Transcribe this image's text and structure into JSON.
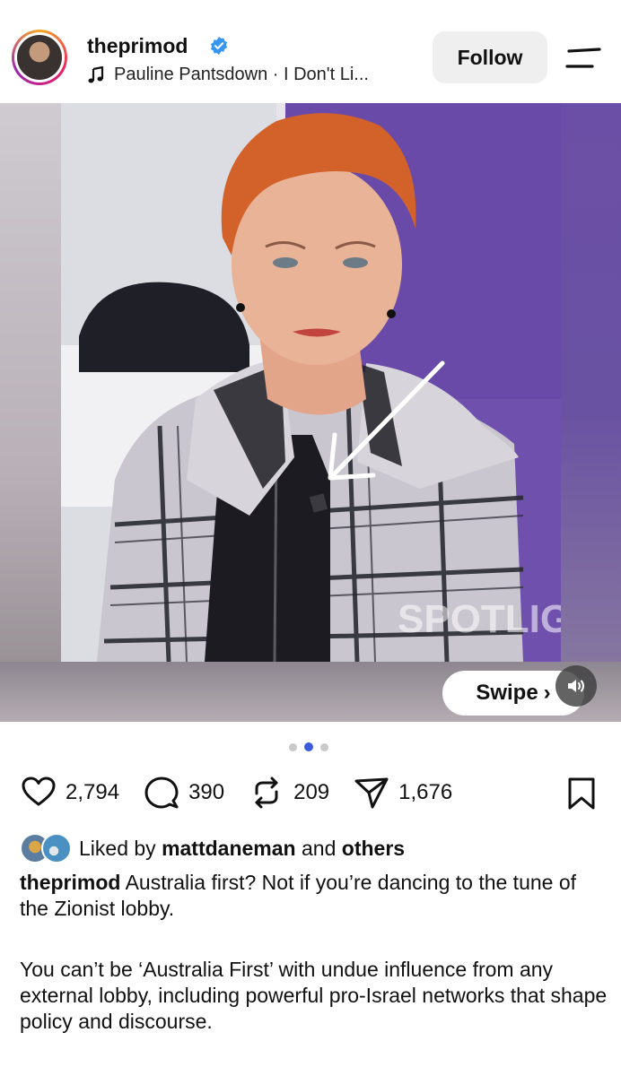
{
  "header": {
    "username": "theprimod",
    "verified_icon": "verified-badge-icon",
    "audio_label": "Pauline Pantsdown · I Don't Li...",
    "follow_label": "Follow"
  },
  "media": {
    "watermark": "SPOTLIGHT",
    "swipe_label": "Swipe",
    "swipe_chevron": "›",
    "carousel_total": 3,
    "carousel_active": 2
  },
  "actions": {
    "likes": "2,794",
    "comments": "390",
    "reposts": "209",
    "shares": "1,676"
  },
  "liked_by": {
    "prefix": "Liked by",
    "user": "mattdaneman",
    "conjunction": "and",
    "others": "others"
  },
  "caption": {
    "author": "theprimod",
    "text": "Australia first? Not if you’re dancing to the tune of the Zionist lobby.",
    "paragraph": "You can’t be ‘Australia First’ with undue influence from any external lobby, including powerful pro-Israel networks that shape policy and discourse."
  },
  "colors": {
    "accent_blue": "#3b5bdb",
    "verified_blue": "#3797f0",
    "follow_bg": "#efeff0"
  }
}
